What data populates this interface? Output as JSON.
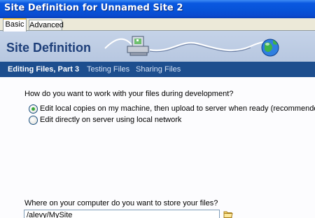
{
  "window": {
    "title": "Site Definition for Unnamed Site 2"
  },
  "tabs": [
    {
      "label": "Basic",
      "active": true
    },
    {
      "label": "Advanced",
      "active": false
    }
  ],
  "banner": {
    "title": "Site Definition",
    "art_icons": [
      "computer-icon",
      "cable-icon",
      "globe-icon"
    ]
  },
  "nav": {
    "current": "Editing Files, Part 3",
    "items": [
      "Testing Files",
      "Sharing Files"
    ]
  },
  "form": {
    "question1": "How do you want to work with your files during development?",
    "options": [
      {
        "label": "Edit local copies on my machine, then upload to server when ready (recommended)",
        "checked": true
      },
      {
        "label": "Edit directly on server using local network",
        "checked": false
      }
    ],
    "question2": "Where on your computer do you want to store your files?",
    "location_value": "/alevy/MySite",
    "browse_icon": "folder-icon"
  },
  "colors": {
    "titlebar": "#0753d8",
    "banner": "#b7c7e0",
    "navbar": "#1d4e8e",
    "radio_selected": "#3aa83a"
  }
}
